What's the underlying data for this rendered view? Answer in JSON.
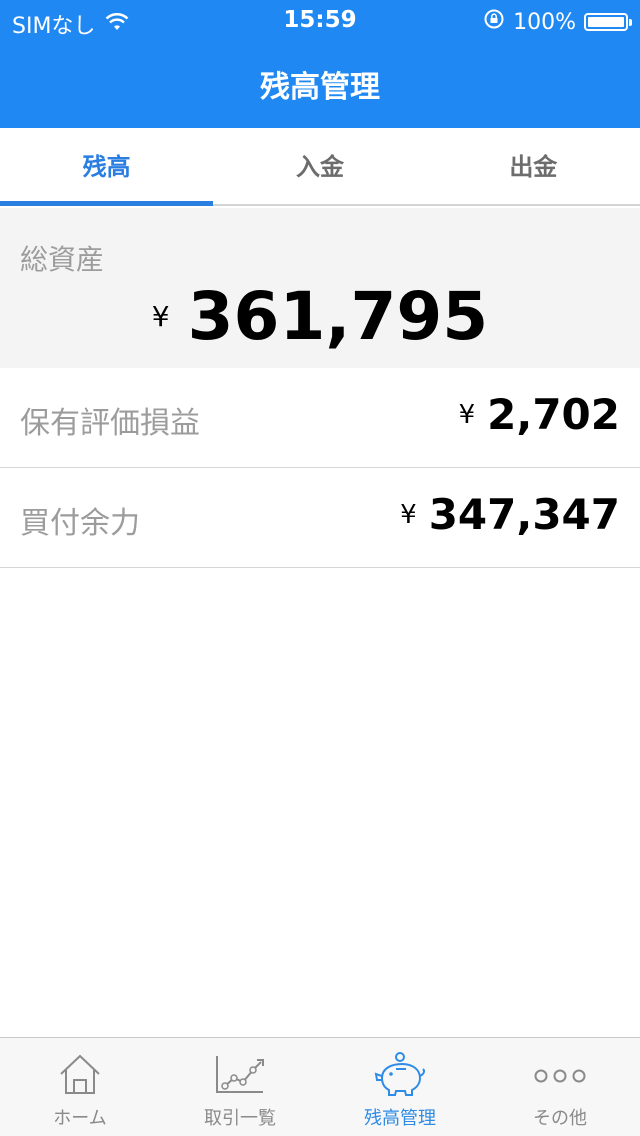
{
  "status_bar": {
    "carrier": "SIMなし",
    "time": "15:59",
    "battery": "100%"
  },
  "nav": {
    "title": "残高管理"
  },
  "tabs": [
    {
      "label": "残高",
      "active": true
    },
    {
      "label": "入金",
      "active": false
    },
    {
      "label": "出金",
      "active": false
    }
  ],
  "total_assets": {
    "label": "総資産",
    "currency": "¥",
    "value": "361,795"
  },
  "rows": [
    {
      "label": "保有評価損益",
      "currency": "¥",
      "value": "2,702"
    },
    {
      "label": "買付余力",
      "currency": "¥",
      "value": "347,347"
    }
  ],
  "tab_bar": [
    {
      "label": "ホーム",
      "icon": "home-icon",
      "active": false
    },
    {
      "label": "取引一覧",
      "icon": "chart-line-icon",
      "active": false
    },
    {
      "label": "残高管理",
      "icon": "piggy-bank-icon",
      "active": true
    },
    {
      "label": "その他",
      "icon": "more-dots-icon",
      "active": false
    }
  ],
  "colors": {
    "accent": "#2088f2",
    "active_tab": "#2a7de1",
    "muted_text": "#9c9c9c"
  }
}
